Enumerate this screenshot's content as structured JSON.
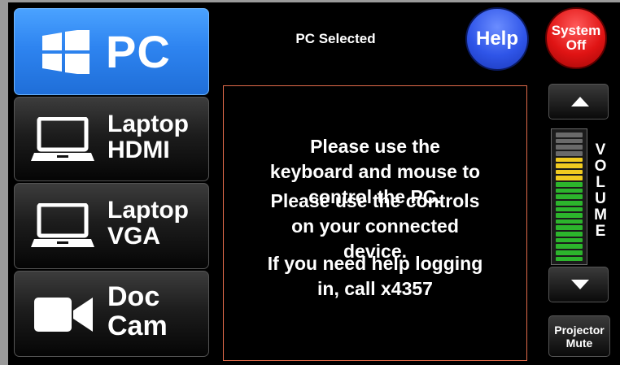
{
  "sources": [
    {
      "id": "pc",
      "line1": "PC",
      "line2": "",
      "icon": "windows-logo-icon",
      "active": true
    },
    {
      "id": "hdmi",
      "line1": "Laptop",
      "line2": "HDMI",
      "icon": "laptop-icon",
      "active": false
    },
    {
      "id": "vga",
      "line1": "Laptop",
      "line2": "VGA",
      "icon": "laptop-icon",
      "active": false
    },
    {
      "id": "doc",
      "line1": "Doc",
      "line2": "Cam",
      "icon": "video-camera-icon",
      "active": false
    }
  ],
  "status": "PC Selected",
  "help_label": "Help",
  "system_off": {
    "line1": "System",
    "line2": "Off"
  },
  "messages": [
    {
      "line1": "Please use the",
      "line2": "keyboard and mouse to",
      "line3": "control the PC."
    },
    {
      "line1": "Please use the controls",
      "line2": "on your connected",
      "line3": "device."
    },
    {
      "line1": "If you need help logging",
      "line2": "in, call x4357",
      "line3": ""
    }
  ],
  "volume": {
    "letters": [
      "V",
      "O",
      "L",
      "U",
      "M",
      "E"
    ],
    "segments": [
      "gray",
      "gray",
      "gray",
      "gray",
      "yellow",
      "yellow",
      "yellow",
      "yellow",
      "green",
      "green",
      "green",
      "green",
      "green",
      "green",
      "green",
      "green",
      "green",
      "green",
      "green",
      "green",
      "green"
    ],
    "level_fraction": 0.81
  },
  "projector_mute": {
    "line1": "Projector",
    "line2": "Mute"
  },
  "colors": {
    "active_source": "#2e84f0",
    "help": "#2f55e8",
    "system_off": "#e01414",
    "meter_yellow": "#f1cb20",
    "meter_green": "#2cb52c",
    "message_border": "#e06a4a"
  }
}
